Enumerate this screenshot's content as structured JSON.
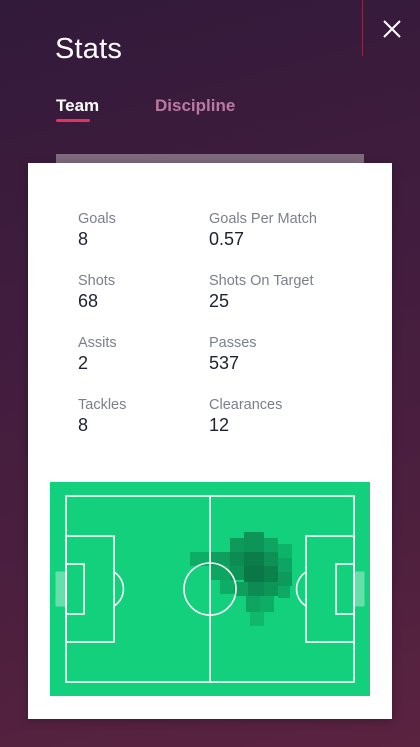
{
  "header": {
    "title": "Stats"
  },
  "tabs": [
    {
      "label": "Team",
      "active": true
    },
    {
      "label": "Discipline",
      "active": false
    }
  ],
  "stats": [
    {
      "label": "Goals",
      "value": "8"
    },
    {
      "label": "Goals Per Match",
      "value": "0.57"
    },
    {
      "label": "Shots",
      "value": "68"
    },
    {
      "label": "Shots On Target",
      "value": "25"
    },
    {
      "label": "Assits",
      "value": "2"
    },
    {
      "label": "Passes",
      "value": "537"
    },
    {
      "label": "Tackles",
      "value": "8"
    },
    {
      "label": "Clearances",
      "value": "12"
    }
  ],
  "icons": {
    "close": "close-icon",
    "pitch": "football-pitch-heatmap"
  },
  "colors": {
    "accent": "#e5325a",
    "pitch_green": "#12d07c",
    "background": "#401c3e"
  }
}
